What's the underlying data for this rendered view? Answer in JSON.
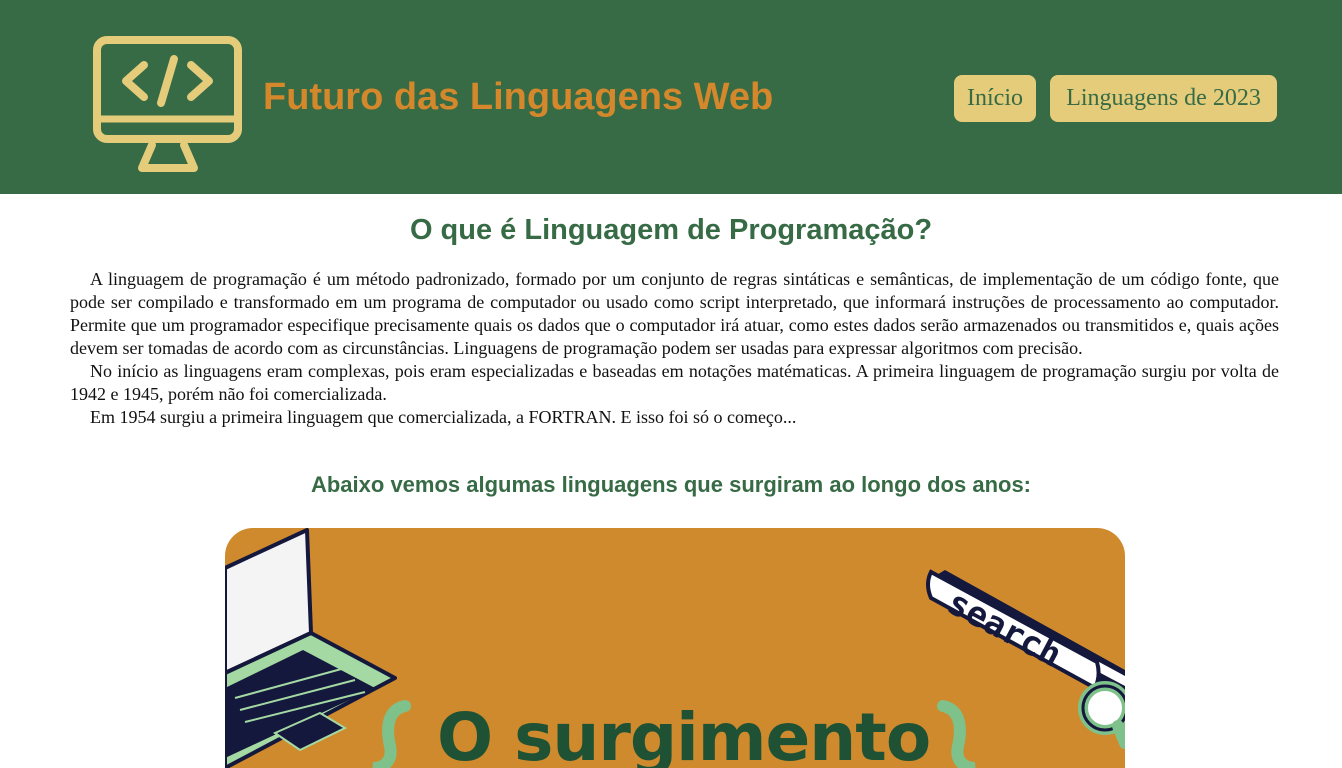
{
  "header": {
    "site_title": "Futuro das Linguagens Web",
    "logo_icon": "code-monitor-icon",
    "nav": [
      {
        "label": "Início"
      },
      {
        "label": "Linguagens de 2023"
      }
    ]
  },
  "main": {
    "heading": "O que é Linguagem de Programação?",
    "paragraphs": [
      "A linguagem de programação é um método padronizado, formado por um conjunto de regras sintáticas e semânticas, de implementação de um código fonte, que pode ser compilado e transformado em um programa de computador ou usado como script interpretado, que informará instruções de processamento ao computador. Permite que um programador especifique precisamente quais os dados que o computador irá atuar, como estes dados serão armazenados ou transmitidos e, quais ações devem ser tomadas de acordo com as circunstâncias. Linguagens de programação podem ser usadas para expressar algoritmos com precisão.",
      "No início as linguagens eram complexas, pois eram especializadas e baseadas em notações matématicas. A primeira linguagem de programação surgiu por volta de 1942 e 1945, porém não foi comercializada.",
      "Em 1954 surgiu a primeira linguagem que comercializada, a FORTRAN. E isso foi só o começo..."
    ],
    "subheading": "Abaixo vemos algumas linguagens que surgiram ao longo dos anos:"
  },
  "banner": {
    "title": "O surgimento",
    "search_label": "search",
    "icons": [
      "laptop-icon",
      "search-bar-icon",
      "magnifier-icon"
    ]
  },
  "colors": {
    "header_bg": "#376b45",
    "title": "#d4882b",
    "nav_bg": "#e4cc7b",
    "heading": "#376b45",
    "banner_bg": "#cf8a2e",
    "banner_title": "#1f5234"
  }
}
